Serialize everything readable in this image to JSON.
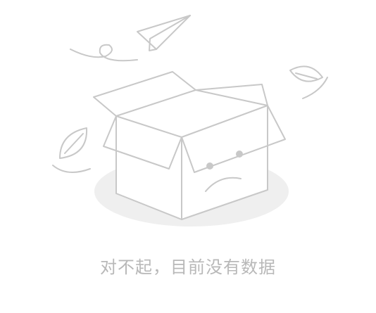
{
  "empty_state": {
    "message": "对不起，目前没有数据",
    "illustration": "empty-box-sad-face",
    "colors": {
      "line": "#c8c8c8",
      "shadow": "#efefef",
      "text": "#b8b8b8"
    }
  }
}
